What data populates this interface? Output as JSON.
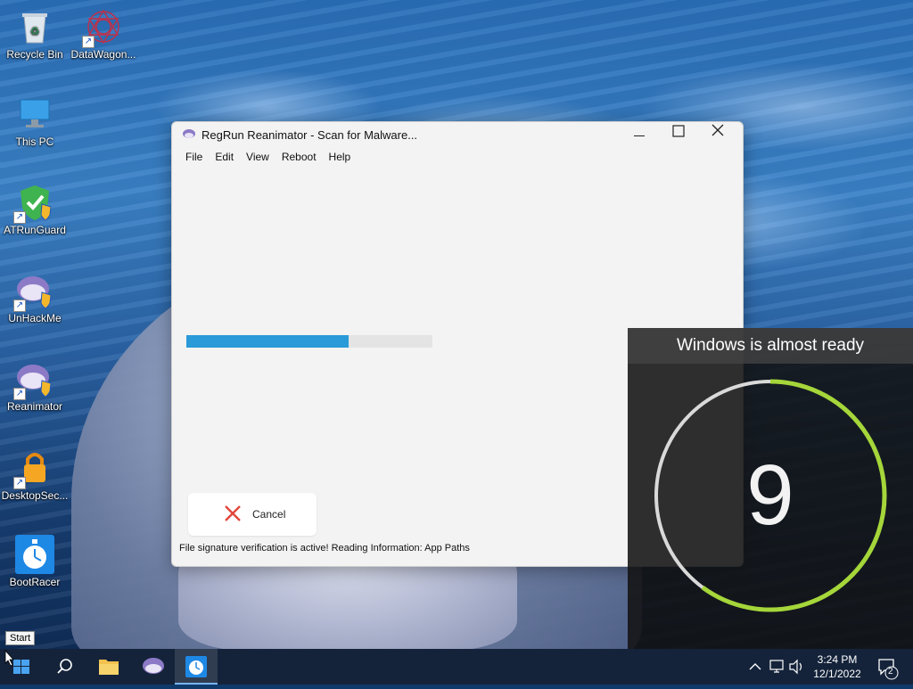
{
  "desktop": {
    "icons": [
      {
        "label": "Recycle Bin"
      },
      {
        "label": "DataWagon..."
      },
      {
        "label": "This PC"
      },
      {
        "label": "ATRunGuard"
      },
      {
        "label": "UnHackMe"
      },
      {
        "label": "Reanimator"
      },
      {
        "label": "DesktopSec..."
      },
      {
        "label": "BootRacer"
      }
    ]
  },
  "window": {
    "title": "RegRun Reanimator - Scan for Malware...",
    "menu": [
      "File",
      "Edit",
      "View",
      "Reboot",
      "Help"
    ],
    "progress": 0.66,
    "cancel_label": "Cancel",
    "status": "File signature verification is active! Reading Information: App Paths"
  },
  "boot_panel": {
    "heading": "Windows is almost ready",
    "countdown": "9",
    "ring_color": "#a5d63a"
  },
  "taskbar": {
    "start_tooltip": "Start",
    "time": "3:24 PM",
    "date": "12/1/2022",
    "notification_count": "2"
  },
  "colors": {
    "accent": "#2a9ad8",
    "cancel_x": "#e2483b"
  }
}
